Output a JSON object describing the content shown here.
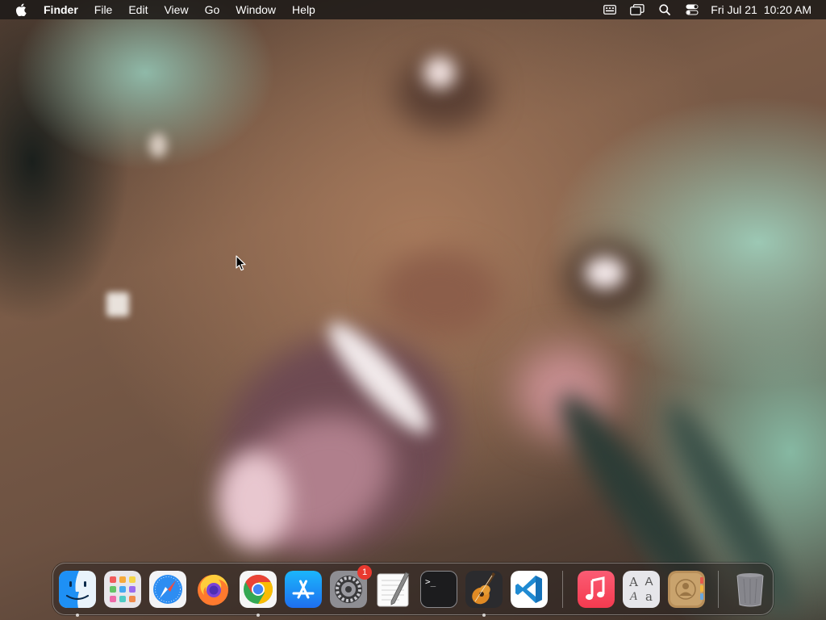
{
  "menubar": {
    "apple_icon": "apple-logo-icon",
    "app_name": "Finder",
    "items": [
      {
        "label": "File"
      },
      {
        "label": "Edit"
      },
      {
        "label": "View"
      },
      {
        "label": "Go"
      },
      {
        "label": "Window"
      },
      {
        "label": "Help"
      }
    ],
    "status_icons": [
      "keyboard-input-icon",
      "window-overlap-icon",
      "search-icon",
      "control-center-icon"
    ],
    "clock": {
      "date": "Fri Jul 21",
      "time": "10:20 AM"
    }
  },
  "dock": {
    "apps": [
      {
        "name": "Finder",
        "icon": "finder-icon",
        "running": true
      },
      {
        "name": "Launchpad",
        "icon": "launchpad-icon",
        "running": false
      },
      {
        "name": "Safari",
        "icon": "safari-icon",
        "running": false
      },
      {
        "name": "Firefox",
        "icon": "firefox-icon",
        "running": false
      },
      {
        "name": "Google Chrome",
        "icon": "chrome-icon",
        "running": true
      },
      {
        "name": "App Store",
        "icon": "app-store-icon",
        "running": false
      },
      {
        "name": "System Settings",
        "icon": "system-settings-icon",
        "running": false,
        "badge": "1"
      },
      {
        "name": "TextEdit",
        "icon": "textedit-icon",
        "running": false
      },
      {
        "name": "Terminal",
        "icon": "terminal-icon",
        "running": false
      },
      {
        "name": "GarageBand",
        "icon": "garageband-icon",
        "running": true
      },
      {
        "name": "Visual Studio Code",
        "icon": "vscode-icon",
        "running": false
      }
    ],
    "others": [
      {
        "name": "Music",
        "icon": "music-icon",
        "running": false
      },
      {
        "name": "Font Book",
        "icon": "font-book-icon",
        "running": false
      },
      {
        "name": "Contacts",
        "icon": "contacts-icon",
        "running": false
      }
    ],
    "trash": {
      "name": "Trash",
      "icon": "trash-icon"
    },
    "font_book_glyphs": [
      "A",
      "A",
      "A",
      "a"
    ],
    "terminal_prompt": ">_"
  },
  "colors": {
    "menubar_bg": "#1e1a18",
    "badge": "#e9392f",
    "vscode_blue": "#1f8ad2",
    "music_red": "#f6415a"
  }
}
